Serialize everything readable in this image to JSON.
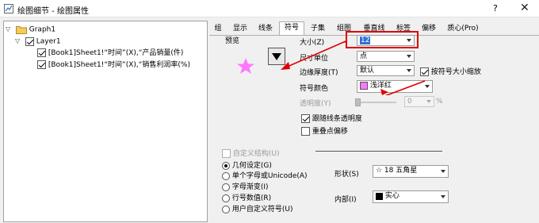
{
  "window": {
    "title": "绘图细节 - 绘图属性",
    "help_label": "?",
    "close_label": "✕"
  },
  "tree": {
    "root": "Graph1",
    "layer": "Layer1",
    "plots": [
      "[Book1]Sheet1!“时间”(X),“产品销量(件)",
      "[Book1]Sheet1!“时间”(X),“销售利润率(%)"
    ]
  },
  "tabs": [
    "组",
    "显示",
    "线条",
    "符号",
    "子集",
    "组图",
    "垂直线",
    "标签",
    "偏移",
    "质心(Pro)"
  ],
  "selected_tab": "符号",
  "symbol": {
    "preview_label": "预览",
    "size_label": "大小(Z)",
    "size_value": "12",
    "size_unit_label": "尺寸单位",
    "size_unit_value": "点",
    "edge_label": "边缘厚度(T)",
    "edge_value": "默认",
    "scale_label": "按符号大小缩放",
    "color_label": "符号颜色",
    "color_value": "浅洋红",
    "color_hex": "#ff77ff",
    "transparency_label": "透明度(Y)",
    "transparency_value": "0",
    "percent_sign": "%",
    "follow_line_label": "跟随线条透明度",
    "overlap_label": "重叠点偏移",
    "custom_structure_label": "自定义结构(U)",
    "radios": [
      "几何设定(G)",
      "单个字母或Unicode(A)",
      "字母渐变(I)",
      "行号数值(R)",
      "用户自定义符号(U)"
    ],
    "shape_label": "形状(S)",
    "shape_value": "☆ 18 五角星",
    "interior_label": "内部(I)",
    "interior_value": "实心",
    "star_color": "#ff77ff",
    "highlight_color": "#e00000"
  }
}
